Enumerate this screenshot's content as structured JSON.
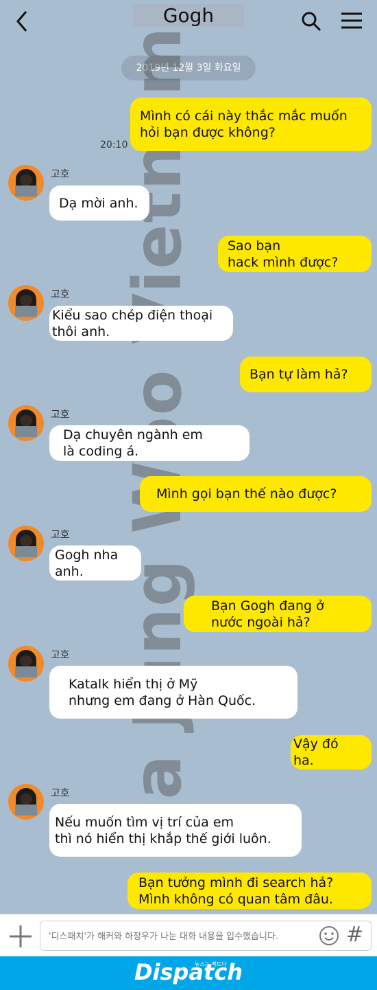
{
  "header": {
    "title": "Gogh",
    "back_icon": "chevron-left-icon",
    "search_icon": "search-icon",
    "menu_icon": "hamburger-menu-icon"
  },
  "date_label": "2019년 12월 3일 화요일",
  "watermark": "Ha Jung Woo Vietnam",
  "sender_name": "고호",
  "messages": [
    {
      "from": "me",
      "text": "Mình có cái này thắc mắc muốn\nhỏi bạn được không?",
      "time": "20:10"
    },
    {
      "from": "other",
      "text": "Dạ mời anh."
    },
    {
      "from": "me",
      "text": "Sao bạn\nhack mình được?"
    },
    {
      "from": "other",
      "text": "Kiểu sao chép điện thoại\nthôi anh."
    },
    {
      "from": "me",
      "text": "Bạn tự làm hả?"
    },
    {
      "from": "other",
      "text": "Dạ chuyên ngành em\nlà coding á."
    },
    {
      "from": "me",
      "text": "Mình gọi bạn thế nào được?"
    },
    {
      "from": "other",
      "text": "Gogh nha anh."
    },
    {
      "from": "me",
      "text": "Bạn Gogh đang ở\nnước ngoài hả?"
    },
    {
      "from": "other",
      "text": "Katalk hiển thị ở Mỹ\nnhưng em đang ở Hàn Quốc."
    },
    {
      "from": "me",
      "text": "Vậy đó ha."
    },
    {
      "from": "other",
      "text": "Nếu muốn tìm vị trí của em\nthì nó hiển thị khắp thế giới luôn."
    },
    {
      "from": "me",
      "text": "Bạn tưởng mình đi search hả?\nMình không có quan tâm đâu."
    }
  ],
  "input": {
    "placeholder": "'디스패치'가 해커와 하정우가 나눈 대화 내용을 입수했습니다.",
    "plus_icon": "plus-icon",
    "emoji_icon": "emoji-icon",
    "hash_symbol": "#"
  },
  "footer": {
    "brand": "Dispatch",
    "tagline": "뉴스는 팩트다"
  },
  "colors": {
    "background": "#a9bdd0",
    "my_bubble": "#ffe800",
    "their_bubble": "#ffffff",
    "footer": "#00a7e8"
  }
}
